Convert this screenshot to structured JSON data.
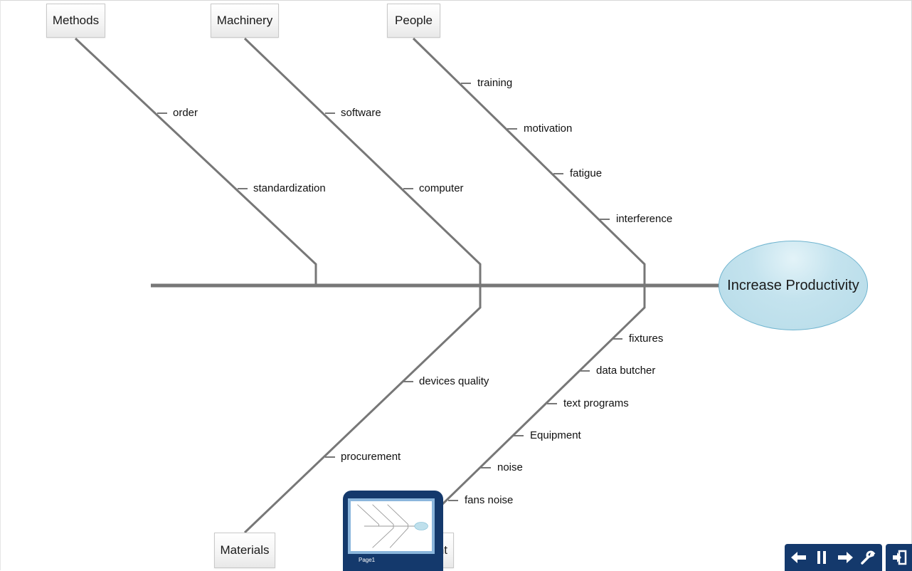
{
  "diagram": {
    "type": "fishbone",
    "effect": "Increase Productivity",
    "categories": [
      {
        "name": "Methods",
        "position": "top",
        "causes": [
          "order",
          "standardization"
        ]
      },
      {
        "name": "Machinery",
        "position": "top",
        "causes": [
          "software",
          "computer"
        ]
      },
      {
        "name": "People",
        "position": "top",
        "causes": [
          "training",
          "motivation",
          "fatigue",
          "interference"
        ]
      },
      {
        "name": "Materials",
        "position": "bottom",
        "causes": [
          "devices quality",
          "procurement"
        ]
      },
      {
        "name": "Environment",
        "visible_text": "nt",
        "position": "bottom",
        "causes": [
          "fixtures",
          "data butcher",
          "text programs",
          "Equipment",
          "noise",
          "fans noise"
        ]
      }
    ]
  },
  "thumbnail": {
    "page_label": "Page1"
  },
  "toolbar": {
    "buttons": [
      {
        "name": "previous",
        "icon": "arrow-left-icon"
      },
      {
        "name": "pause",
        "icon": "pause-icon"
      },
      {
        "name": "next",
        "icon": "arrow-right-icon"
      },
      {
        "name": "settings",
        "icon": "wrench-icon"
      }
    ],
    "exit": {
      "name": "exit",
      "icon": "exit-door-icon"
    }
  },
  "colors": {
    "bone": "#777777",
    "effect_fill": "#bfe0ec",
    "effect_border": "#6fb4cf",
    "panel": "#14396c"
  }
}
